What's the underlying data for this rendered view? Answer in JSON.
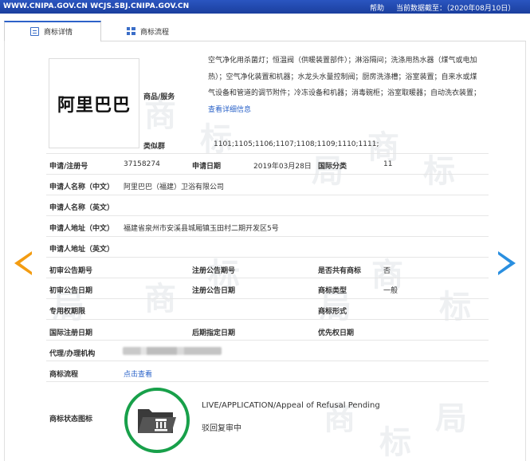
{
  "topbar": {
    "url": "WWW.CNIPA.GOV.CN WCJS.SBJ.CNIPA.GOV.CN",
    "help": "帮助",
    "data_date": "当前数据截至：（2020年08月10日）"
  },
  "tabs": [
    {
      "label": "商标详情",
      "icon": "document-icon",
      "active": true
    },
    {
      "label": "商标流程",
      "icon": "grid-icon",
      "active": false
    }
  ],
  "mark": {
    "name": "阿里巴巴",
    "goods_label": "商品/服务",
    "goods_text": "空气净化用杀菌灯；恒温阀（供暖装置部件）；淋浴隔间；洗涤用热水器（煤气或电加热）；空气净化装置和机器；水龙头水量控制阀；厨房洗涤槽；浴室装置；自来水或煤气设备和管道的调节附件；冷冻设备和机器；消毒碗柜；浴室取暖器；自动洗衣装置；",
    "goods_more": "查看详细信息",
    "similar_label": "类似群",
    "similar_value": "1101;1105;1106;1107;1108;1109;1110;1111;"
  },
  "fields": {
    "reg_no_label": "申请/注册号",
    "reg_no": "37158274",
    "app_date_label": "申请日期",
    "app_date": "2019年03月28日",
    "intl_class_label": "国际分类",
    "intl_class": "11",
    "applicant_cn_label": "申请人名称（中文）",
    "applicant_cn": "阿里巴巴（福建）卫浴有限公司",
    "applicant_en_label": "申请人名称（英文）",
    "address_cn_label": "申请人地址（中文）",
    "address_cn": "福建省泉州市安溪县城厢镇玉田村二期开发区5号",
    "address_en_label": "申请人地址（英文）",
    "prelim_no_label": "初审公告期号",
    "reg_notice_no_label": "注册公告期号",
    "shared_label": "是否共有商标",
    "shared": "否",
    "prelim_date_label": "初审公告日期",
    "reg_notice_date_label": "注册公告日期",
    "mark_type_label": "商标类型",
    "mark_type": "一般",
    "exclusive_label": "专用权期限",
    "mark_form_label": "商标形式",
    "intl_reg_date_label": "国际注册日期",
    "later_date_label": "后期指定日期",
    "priority_date_label": "优先权日期",
    "agent_label": "代理/办理机构",
    "process_label": "商标流程",
    "process_link": "点击查看",
    "status_label": "商标状态图标",
    "status_en": "LIVE/APPLICATION/Appeal of Refusal Pending",
    "status_cn": "驳回复审中"
  },
  "colors": {
    "topbar": "#1b3f9e",
    "link": "#2a62c8",
    "status_ring": "#18a04a",
    "prev_arrow": "#f39c12",
    "next_arrow": "#2a8fe0"
  }
}
